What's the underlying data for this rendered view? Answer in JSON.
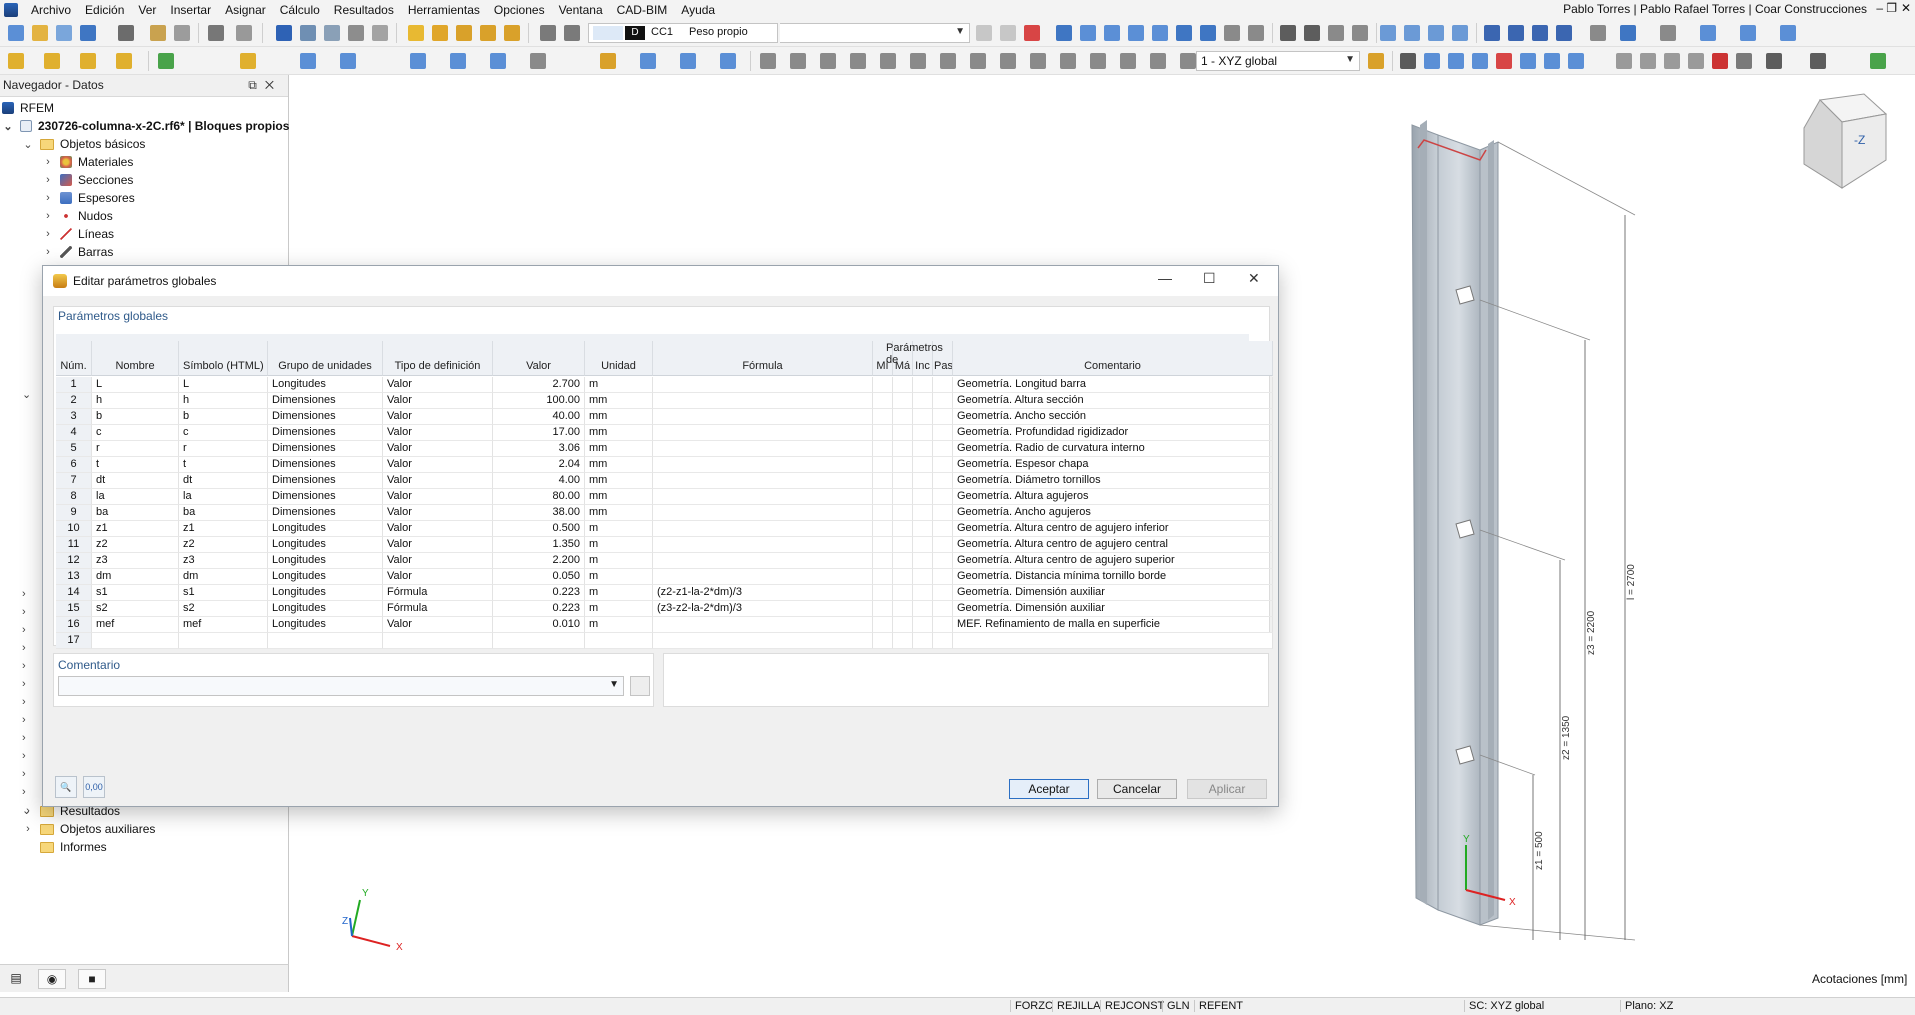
{
  "menu": {
    "items": [
      "Archivo",
      "Edición",
      "Ver",
      "Insertar",
      "Asignar",
      "Cálculo",
      "Resultados",
      "Herramientas",
      "Opciones",
      "Ventana",
      "CAD-BIM",
      "Ayuda"
    ],
    "user": "Pablo Torres | Pablo Rafael Torres | Coar Construcciones"
  },
  "toolbar": {
    "load_type": "D",
    "load_case_code": "CC1",
    "load_case_name": "Peso propio",
    "coord_system": "1 - XYZ global"
  },
  "navigator": {
    "title": "Navegador - Datos",
    "root": "RFEM",
    "file": "230726-columna-x-2C.rf6* | Bloques propios",
    "basic_folder": "Objetos básicos",
    "items": [
      "Materiales",
      "Secciones",
      "Espesores",
      "Nudos",
      "Líneas",
      "Barras"
    ],
    "bottom_folders": [
      "Resultados",
      "Objetos auxiliares",
      "Informes"
    ]
  },
  "viewport": {
    "cube_label": "-Z",
    "axis_x": "X",
    "axis_y": "Y",
    "axis_z": "Z",
    "dimensions_label": "Acotaciones [mm]",
    "dim_l": "l = 2700",
    "dim_z3": "z3 = 2200",
    "dim_z2": "z2 = 1350",
    "dim_z1": "z1 = 500"
  },
  "dialog": {
    "title": "Editar parámetros globales",
    "panel_title": "Parámetros globales",
    "columns": {
      "num": "Núm.",
      "name": "Nombre",
      "symbol": "Símbolo (HTML)",
      "group": "Grupo de unidades",
      "def_type": "Tipo de definición",
      "value": "Valor",
      "unit": "Unidad",
      "formula": "Fórmula",
      "params_group": "Parámetros de",
      "min": "Mí",
      "max": "Má",
      "inc": "Inc",
      "pas": "Pas",
      "comment": "Comentario"
    },
    "rows": [
      {
        "n": "1",
        "name": "L",
        "sym": "L",
        "group": "Longitudes",
        "type": "Valor",
        "value": "2.700",
        "unit": "m",
        "formula": "",
        "comment": "Geometría. Longitud barra"
      },
      {
        "n": "2",
        "name": "h",
        "sym": "h",
        "group": "Dimensiones",
        "type": "Valor",
        "value": "100.00",
        "unit": "mm",
        "formula": "",
        "comment": "Geometría. Altura sección"
      },
      {
        "n": "3",
        "name": "b",
        "sym": "b",
        "group": "Dimensiones",
        "type": "Valor",
        "value": "40.00",
        "unit": "mm",
        "formula": "",
        "comment": "Geometría. Ancho sección"
      },
      {
        "n": "4",
        "name": "c",
        "sym": "c",
        "group": "Dimensiones",
        "type": "Valor",
        "value": "17.00",
        "unit": "mm",
        "formula": "",
        "comment": "Geometría. Profundidad rigidizador"
      },
      {
        "n": "5",
        "name": "r",
        "sym": "r",
        "group": "Dimensiones",
        "type": "Valor",
        "value": "3.06",
        "unit": "mm",
        "formula": "",
        "comment": "Geometría. Radio de curvatura interno"
      },
      {
        "n": "6",
        "name": "t",
        "sym": "t",
        "group": "Dimensiones",
        "type": "Valor",
        "value": "2.04",
        "unit": "mm",
        "formula": "",
        "comment": "Geometría. Espesor chapa"
      },
      {
        "n": "7",
        "name": "dt",
        "sym": "dt",
        "group": "Dimensiones",
        "type": "Valor",
        "value": "4.00",
        "unit": "mm",
        "formula": "",
        "comment": "Geometría. Diámetro tornillos"
      },
      {
        "n": "8",
        "name": "la",
        "sym": "la",
        "group": "Dimensiones",
        "type": "Valor",
        "value": "80.00",
        "unit": "mm",
        "formula": "",
        "comment": "Geometría. Altura agujeros"
      },
      {
        "n": "9",
        "name": "ba",
        "sym": "ba",
        "group": "Dimensiones",
        "type": "Valor",
        "value": "38.00",
        "unit": "mm",
        "formula": "",
        "comment": "Geometría. Ancho agujeros"
      },
      {
        "n": "10",
        "name": "z1",
        "sym": "z1",
        "group": "Longitudes",
        "type": "Valor",
        "value": "0.500",
        "unit": "m",
        "formula": "",
        "comment": "Geometría. Altura centro de agujero inferior"
      },
      {
        "n": "11",
        "name": "z2",
        "sym": "z2",
        "group": "Longitudes",
        "type": "Valor",
        "value": "1.350",
        "unit": "m",
        "formula": "",
        "comment": "Geometría. Altura centro de agujero central"
      },
      {
        "n": "12",
        "name": "z3",
        "sym": "z3",
        "group": "Longitudes",
        "type": "Valor",
        "value": "2.200",
        "unit": "m",
        "formula": "",
        "comment": "Geometría. Altura centro de agujero superior"
      },
      {
        "n": "13",
        "name": "dm",
        "sym": "dm",
        "group": "Longitudes",
        "type": "Valor",
        "value": "0.050",
        "unit": "m",
        "formula": "",
        "comment": "Geometría. Distancia mínima tornillo borde"
      },
      {
        "n": "14",
        "name": "s1",
        "sym": "s1",
        "group": "Longitudes",
        "type": "Fórmula",
        "value": "0.223",
        "unit": "m",
        "formula": "(z2-z1-la-2*dm)/3",
        "comment": "Geometría. Dimensión auxiliar"
      },
      {
        "n": "15",
        "name": "s2",
        "sym": "s2",
        "group": "Longitudes",
        "type": "Fórmula",
        "value": "0.223",
        "unit": "m",
        "formula": "(z3-z2-la-2*dm)/3",
        "comment": "Geometría. Dimensión auxiliar"
      },
      {
        "n": "16",
        "name": "mef",
        "sym": "mef",
        "group": "Longitudes",
        "type": "Valor",
        "value": "0.010",
        "unit": "m",
        "formula": "",
        "comment": "MEF. Refinamiento de malla en superficie"
      },
      {
        "n": "17",
        "name": "",
        "sym": "",
        "group": "",
        "type": "",
        "value": "",
        "unit": "",
        "formula": "",
        "comment": ""
      }
    ],
    "comment_label": "Comentario",
    "units_button": "0,00",
    "ok": "Aceptar",
    "cancel": "Cancelar",
    "apply": "Aplicar"
  },
  "statusbar": {
    "items": [
      "FORZC",
      "REJILLA",
      "REJCONST",
      "GLN",
      "REFENT"
    ],
    "cs": "SC: XYZ global",
    "plane": "Plano: XZ"
  }
}
